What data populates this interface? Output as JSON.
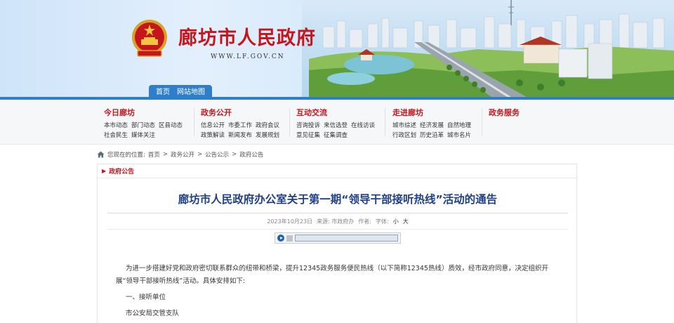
{
  "header": {
    "site_title": "廊坊市人民政府",
    "site_url": "WWW.LF.GOV.CN",
    "topnav": [
      "首页",
      "网站地图"
    ]
  },
  "menu": [
    {
      "title": "今日廊坊",
      "rows": [
        [
          "本市动态",
          "部门动态",
          "区县动态"
        ],
        [
          "社会民生",
          "媒体关注"
        ]
      ]
    },
    {
      "title": "政务公开",
      "rows": [
        [
          "信息公开",
          "市委工作",
          "政府会议"
        ],
        [
          "政策解读",
          "新闻发布",
          "发展规划"
        ]
      ]
    },
    {
      "title": "互动交流",
      "rows": [
        [
          "咨询投诉",
          "来信选登",
          "在线访谈"
        ],
        [
          "意见征集",
          "征集调查"
        ]
      ]
    },
    {
      "title": "走进廊坊",
      "rows": [
        [
          "城市综述",
          "经济发展",
          "自然地理"
        ],
        [
          "行政区划",
          "历史沿革",
          "城市名片"
        ]
      ]
    },
    {
      "title": "政务服务",
      "rows": []
    }
  ],
  "breadcrumb": {
    "label": "您现在的位置:",
    "items": [
      "首页",
      "政务公开",
      "公告公示",
      "政府公告"
    ],
    "separator": ">"
  },
  "panel": {
    "section": "政府公告",
    "title": "廊坊市人民政府办公室关于第一期“领导干部接听热线”活动的通告",
    "meta": {
      "date": "2023年10月23日",
      "source": "来源: 市政府办",
      "author": "作者:",
      "font_label": "字体:",
      "font_small": "小",
      "font_large": "大"
    },
    "paragraphs": [
      "为进一步搭建好党和政府密切联系群众的纽带和桥梁，提升12345政务服务便民热线（以下简称12345热线）质效，经市政府同意，决定组织开展“领导干部接听热线”活动。具体安排如下:",
      "一、接听单位",
      "市公安局交管支队"
    ]
  },
  "colors": {
    "brand_red": "#c4161c",
    "nav_blue": "#2f7ec9",
    "title_blue": "#1f3f86"
  },
  "icons": [
    "national-emblem-icon",
    "home-icon",
    "play-icon",
    "stop-icon",
    "arrow-right-icon"
  ]
}
